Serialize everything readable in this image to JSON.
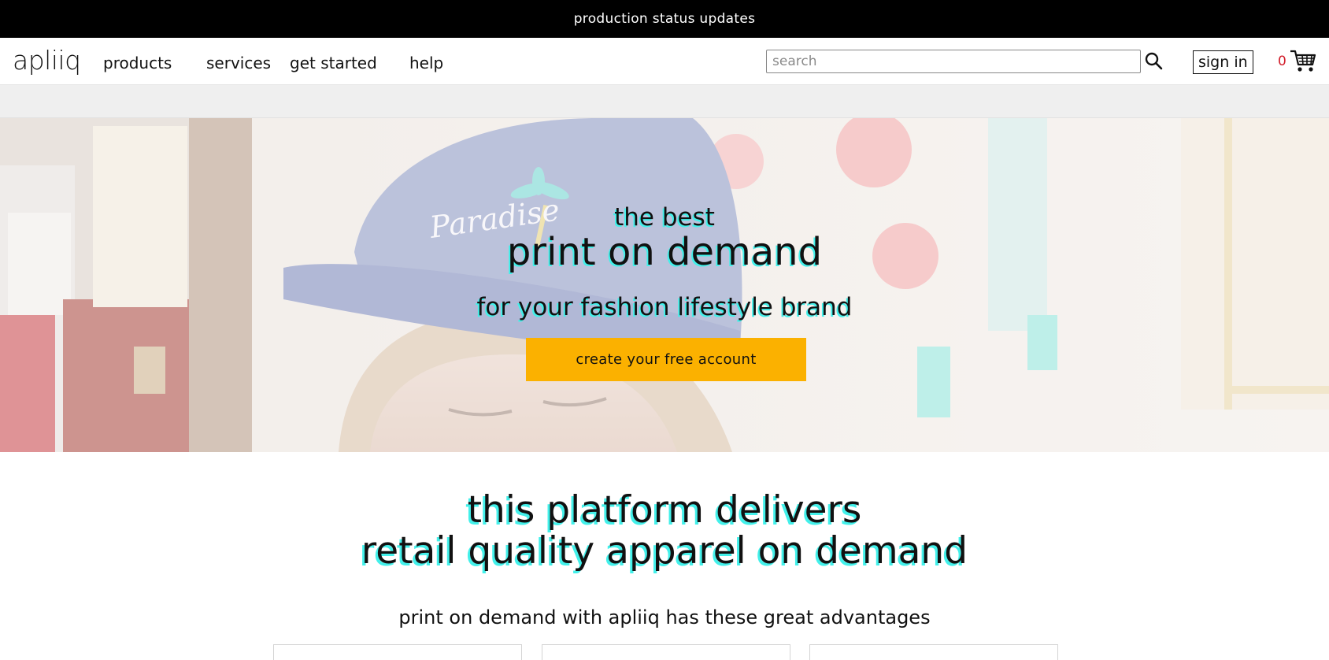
{
  "announcement": {
    "text": "production status updates"
  },
  "header": {
    "logo_text": "apliiq",
    "nav": [
      {
        "label": "products"
      },
      {
        "label": "services"
      },
      {
        "label": "get started"
      },
      {
        "label": "help"
      }
    ],
    "search": {
      "placeholder": "search",
      "value": ""
    },
    "sign_in_label": "sign in",
    "cart_count": "0"
  },
  "hero": {
    "kicker": "the best",
    "title": "print on demand",
    "subtitle": "for your fashion lifestyle brand",
    "cta_label": "create your free account",
    "cap_text": "Paradise"
  },
  "section": {
    "title_line1": "this platform delivers",
    "title_line2": "retail quality apparel on demand",
    "subtitle": "print on demand with apliiq has these great advantages"
  },
  "colors": {
    "cta": "#fbb100",
    "text_shadow_accent": "#43f0ea",
    "cart_count": "#d21e2b",
    "topbar": "#000000"
  }
}
